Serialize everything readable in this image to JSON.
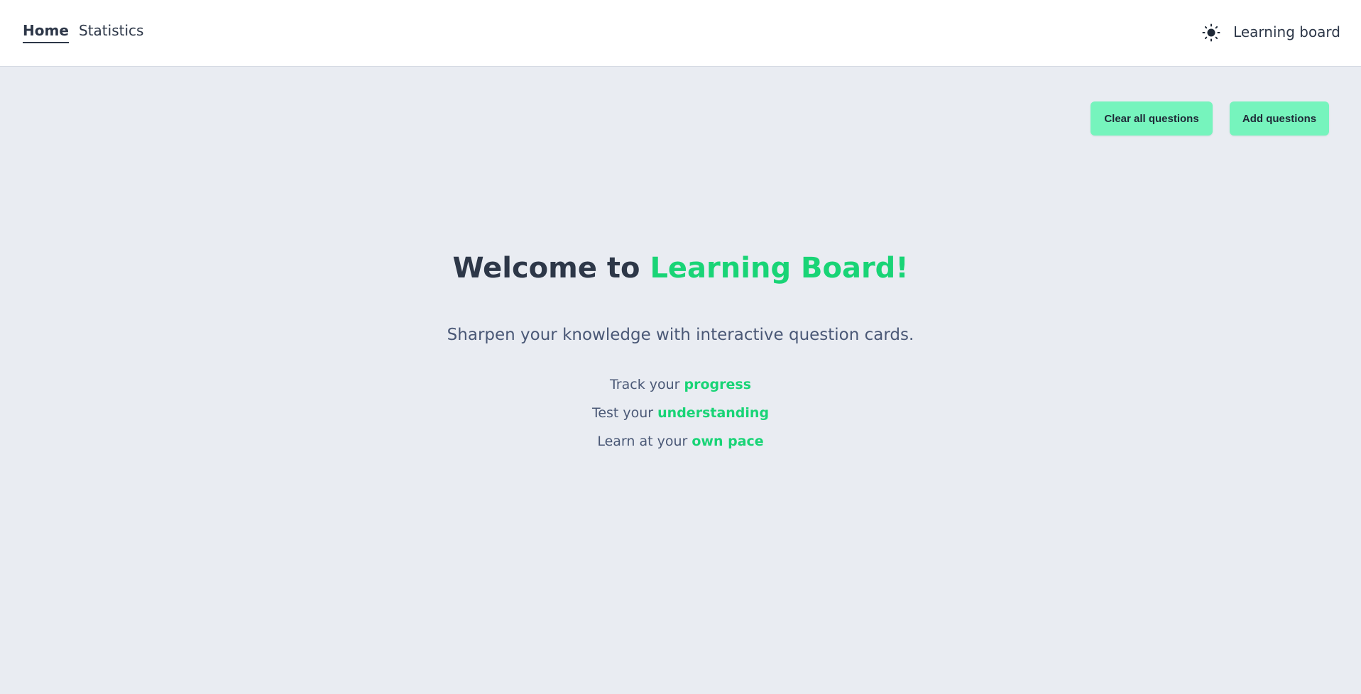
{
  "nav": {
    "home_label": "Home",
    "statistics_label": "Statistics",
    "theme_icon": "sun-icon",
    "brand": "Learning board"
  },
  "actions": {
    "clear_label": "Clear all questions",
    "add_label": "Add questions"
  },
  "hero": {
    "title_prefix": "Welcome to ",
    "title_accent": "Learning Board!",
    "subtitle": "Sharpen your knowledge with interactive question cards.",
    "features": [
      {
        "prefix": "Track your ",
        "accent": "progress"
      },
      {
        "prefix": "Test your ",
        "accent": "understanding"
      },
      {
        "prefix": "Learn at your ",
        "accent": "own pace"
      }
    ]
  },
  "colors": {
    "accent": "#19d476",
    "button": "#76f4bd",
    "background": "#e9ecf2",
    "text": "#2d3748"
  }
}
